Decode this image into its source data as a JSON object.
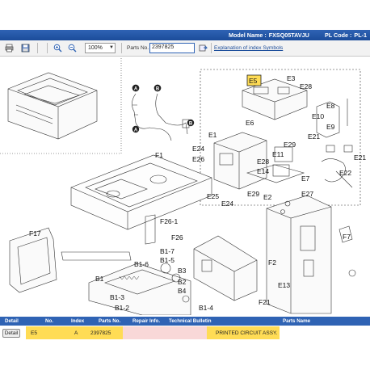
{
  "header": {
    "model_label": "Model Name :",
    "model_value": "FXSQ05TAVJU",
    "plcode_label": "PL Code :",
    "plcode_value": "PL-1"
  },
  "toolbar": {
    "icons": [
      "print-icon",
      "save-icon",
      "zoom-in-icon",
      "zoom-out-icon"
    ],
    "zoom_value": "100%",
    "parts_label": "Parts No.",
    "parts_value": "2397825",
    "explain_link": "Explanation of index Symbols"
  },
  "diagram": {
    "labels": [
      "E5",
      "E3",
      "E28",
      "E6",
      "E8",
      "E10",
      "E9",
      "E21",
      "E1",
      "E24",
      "E26",
      "E28",
      "E14",
      "E29",
      "E7",
      "E11",
      "E29",
      "E27",
      "E2",
      "E25",
      "E24",
      "E22",
      "E21",
      "F1",
      "F26-1",
      "F26",
      "F17",
      "F2",
      "F7",
      "B1-7",
      "B1-6",
      "B1-5",
      "B1",
      "B3",
      "B2",
      "B4",
      "B1-3",
      "B1-2",
      "B1-4",
      "E13",
      "F21"
    ],
    "callouts": [
      "A",
      "B"
    ]
  },
  "table": {
    "headers": [
      "Detail",
      "No.",
      "Index",
      "Parts No.",
      "Repair Info.",
      "Technical Bulletin",
      "Parts Name"
    ],
    "rows": [
      {
        "detail_button": "Detail",
        "no": "E5",
        "index": "A",
        "parts_no": "2397825",
        "repair_info": "",
        "technical_bulletin": "",
        "parts_name": "PRINTED CIRCUIT ASSY."
      }
    ]
  },
  "colors": {
    "title_bar": "#2f63b4",
    "highlight_yellow": "#ffdc55",
    "highlight_pink": "#f9d8d8"
  }
}
